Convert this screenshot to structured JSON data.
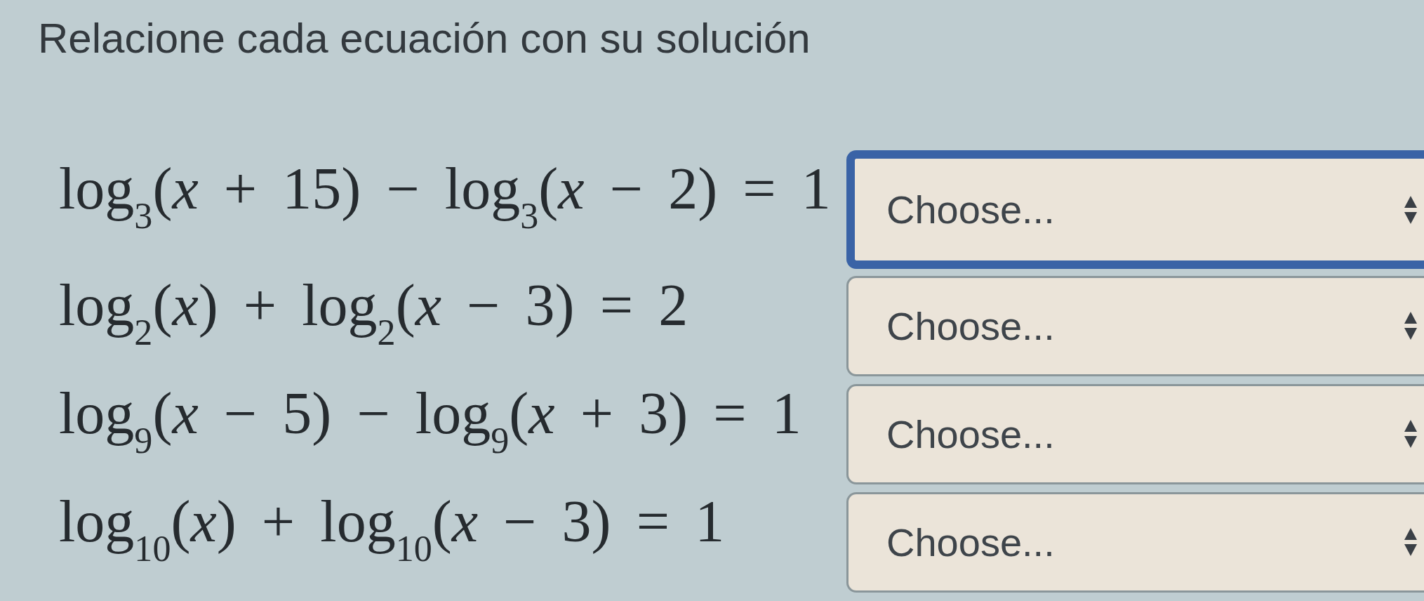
{
  "instruction": "Relacione cada ecuación con su solución",
  "rows": [
    {
      "equation": "log$_{3}$(*x* + 15) − log$_{3}$(*x* − 2) = 1",
      "answer": {
        "value": "Choose...",
        "focused": true
      }
    },
    {
      "equation": "log$_{2}$(*x*) + log$_{2}$(*x* − 3) = 2",
      "answer": {
        "value": "Choose...",
        "focused": false
      }
    },
    {
      "equation": "log$_{9}$(*x* − 5) − log$_{9}$(*x* + 3) = 1",
      "answer": {
        "value": "Choose...",
        "focused": false
      }
    },
    {
      "equation": "log$_{10}$(*x*) + log$_{10}$(*x* − 3) = 1",
      "answer": {
        "value": "Choose...",
        "focused": false
      }
    }
  ]
}
